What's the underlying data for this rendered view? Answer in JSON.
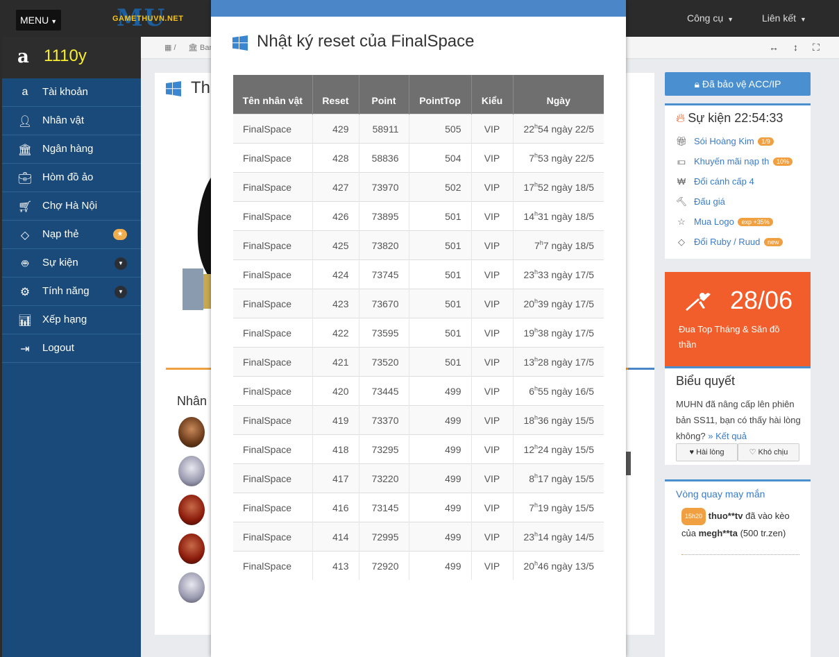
{
  "navbar": {
    "menu_label": "MENU",
    "logo_text": "GAMETHUVN.NET",
    "logo_watermark": "MU",
    "tools_label": "Công cụ",
    "links_label": "Liên kết"
  },
  "sidebar": {
    "username": "1110y",
    "items": [
      {
        "label": "Tài khoản",
        "icon": "amazon-icon"
      },
      {
        "label": "Nhân vật",
        "icon": "user-icon"
      },
      {
        "label": "Ngân hàng",
        "icon": "bank-icon"
      },
      {
        "label": "Hòm đồ ảo",
        "icon": "briefcase-icon"
      },
      {
        "label": "Chợ Hà Nội",
        "icon": "cart-icon"
      },
      {
        "label": "Nạp thẻ",
        "icon": "diamond-icon"
      },
      {
        "label": "Sự kiện",
        "icon": "android-icon"
      },
      {
        "label": "Tính năng",
        "icon": "gears-icon"
      },
      {
        "label": "Xếp hạng",
        "icon": "bar-chart-icon"
      },
      {
        "label": "Logout",
        "icon": "sign-out-icon"
      }
    ]
  },
  "breadcrumb": {
    "item": "Ban"
  },
  "main_panel": {
    "title": "Th",
    "section_label": "Nhân"
  },
  "right": {
    "protect_button": "Đã bảo vệ ACC/IP",
    "event_title": "Sự kiện 22:54:33",
    "events": [
      {
        "label": "Sói Hoàng Kim",
        "badge": "1/9",
        "icon": "gift-icon"
      },
      {
        "label": "Khuyến mãi nạp th",
        "badge": "10%",
        "icon": "money-icon"
      },
      {
        "label": "Đổi cánh cấp 4",
        "badge": "",
        "icon": "won-icon"
      },
      {
        "label": "Đấu giá",
        "badge": "",
        "icon": "gavel-icon"
      },
      {
        "label": "Mua Logo",
        "badge": "exp +35%",
        "icon": "star-icon"
      },
      {
        "label": "Đổi Ruby / Ruud",
        "badge": "new",
        "icon": "diamond-icon"
      }
    ],
    "promo_date": "28/06",
    "promo_text": "Đua Top Tháng & Săn đồ thần",
    "vote_title": "Biểu quyết",
    "vote_question": "MUHN đã nâng cấp lên phiên bản SS11, bạn có thấy hài lòng không?",
    "vote_result_link": "» Kết quả",
    "vote_yes": "Hài lòng",
    "vote_no": "Khó chịu",
    "spin_title": "Vòng quay may mắn",
    "spin_time": "15h20",
    "spin_user": "thuo**tv",
    "spin_mid": "đã vào kèo của",
    "spin_target": "megh**ta",
    "spin_amount": "(500 tr.zen)"
  },
  "modal": {
    "title": "Nhật ký reset của FinalSpace",
    "headers": [
      "Tên nhân vật",
      "Reset",
      "Point",
      "PointTop",
      "Kiểu",
      "Ngày"
    ],
    "rows": [
      {
        "name": "FinalSpace",
        "reset": "429",
        "point": "58911",
        "top": "505",
        "kieu": "VIP",
        "h": "22",
        "m": "54",
        "d": "22/5"
      },
      {
        "name": "FinalSpace",
        "reset": "428",
        "point": "58836",
        "top": "504",
        "kieu": "VIP",
        "h": "7",
        "m": "53",
        "d": "22/5"
      },
      {
        "name": "FinalSpace",
        "reset": "427",
        "point": "73970",
        "top": "502",
        "kieu": "VIP",
        "h": "17",
        "m": "52",
        "d": "18/5"
      },
      {
        "name": "FinalSpace",
        "reset": "426",
        "point": "73895",
        "top": "501",
        "kieu": "VIP",
        "h": "14",
        "m": "31",
        "d": "18/5"
      },
      {
        "name": "FinalSpace",
        "reset": "425",
        "point": "73820",
        "top": "501",
        "kieu": "VIP",
        "h": "7",
        "m": "7",
        "d": "18/5"
      },
      {
        "name": "FinalSpace",
        "reset": "424",
        "point": "73745",
        "top": "501",
        "kieu": "VIP",
        "h": "23",
        "m": "33",
        "d": "17/5"
      },
      {
        "name": "FinalSpace",
        "reset": "423",
        "point": "73670",
        "top": "501",
        "kieu": "VIP",
        "h": "20",
        "m": "39",
        "d": "17/5"
      },
      {
        "name": "FinalSpace",
        "reset": "422",
        "point": "73595",
        "top": "501",
        "kieu": "VIP",
        "h": "19",
        "m": "38",
        "d": "17/5"
      },
      {
        "name": "FinalSpace",
        "reset": "421",
        "point": "73520",
        "top": "501",
        "kieu": "VIP",
        "h": "13",
        "m": "28",
        "d": "17/5"
      },
      {
        "name": "FinalSpace",
        "reset": "420",
        "point": "73445",
        "top": "499",
        "kieu": "VIP",
        "h": "6",
        "m": "55",
        "d": "16/5"
      },
      {
        "name": "FinalSpace",
        "reset": "419",
        "point": "73370",
        "top": "499",
        "kieu": "VIP",
        "h": "18",
        "m": "36",
        "d": "15/5"
      },
      {
        "name": "FinalSpace",
        "reset": "418",
        "point": "73295",
        "top": "499",
        "kieu": "VIP",
        "h": "12",
        "m": "24",
        "d": "15/5"
      },
      {
        "name": "FinalSpace",
        "reset": "417",
        "point": "73220",
        "top": "499",
        "kieu": "VIP",
        "h": "8",
        "m": "17",
        "d": "15/5"
      },
      {
        "name": "FinalSpace",
        "reset": "416",
        "point": "73145",
        "top": "499",
        "kieu": "VIP",
        "h": "7",
        "m": "19",
        "d": "15/5"
      },
      {
        "name": "FinalSpace",
        "reset": "414",
        "point": "72995",
        "top": "499",
        "kieu": "VIP",
        "h": "23",
        "m": "14",
        "d": "14/5"
      },
      {
        "name": "FinalSpace",
        "reset": "413",
        "point": "72920",
        "top": "499",
        "kieu": "VIP",
        "h": "20",
        "m": "46",
        "d": "13/5"
      }
    ]
  }
}
